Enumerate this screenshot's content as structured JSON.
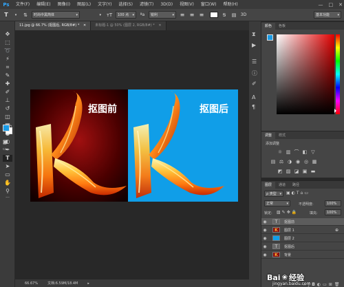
{
  "menu": {
    "logo": "Ps",
    "items": [
      "文件(F)",
      "编辑(E)",
      "图像(I)",
      "图层(L)",
      "文字(Y)",
      "选择(S)",
      "滤镜(T)",
      "3D(D)",
      "视图(V)",
      "窗口(W)",
      "帮助(H)"
    ]
  },
  "options": {
    "font_family": "时尚中黑简体",
    "font_size": "100 点",
    "antialias": "锐利",
    "workspace": "基本功能"
  },
  "tabs": [
    {
      "label": "11.jpg @ 66.7% (抠图后, RGB/8#) *",
      "active": true
    },
    {
      "label": "未标题-1 @ 50% (图层 2, RGB/8#) *",
      "active": false
    }
  ],
  "photo": {
    "left_label": "抠图前",
    "right_label": "抠图后",
    "left_bg": "#3a0000",
    "right_bg": "#109ee8"
  },
  "status": {
    "zoom": "66.67%",
    "doc_info": "文档:6.59M/18.4M"
  },
  "color_panel": {
    "tabs": [
      "颜色",
      "色板"
    ]
  },
  "adjust_panel": {
    "tabs": [
      "调整",
      "样式"
    ],
    "title": "添加调整"
  },
  "layers_panel": {
    "tabs": [
      "图层",
      "通道",
      "路径"
    ],
    "filter_kind": "ρ 类型",
    "blend_mode": "正常",
    "opacity_label": "不透明度:",
    "opacity_value": "100%",
    "lock_label": "锁定:",
    "fill_label": "填充:",
    "fill_value": "100%",
    "layers": [
      {
        "name": "抠图前",
        "thumb": "T",
        "selected": true
      },
      {
        "name": "图层 1",
        "thumb": "K",
        "selected": false
      },
      {
        "name": "图层 2",
        "thumb": "",
        "selected": false
      },
      {
        "name": "抠图后",
        "thumb": "T",
        "selected": false
      },
      {
        "name": "背景",
        "thumb": "K",
        "selected": false
      }
    ]
  },
  "watermark": {
    "brand": "Bai",
    "brand_cn": "经验",
    "url": "jingyan.baidu.com"
  },
  "colors": {
    "fg": "#1a9be6",
    "bg": "#ffffff"
  }
}
